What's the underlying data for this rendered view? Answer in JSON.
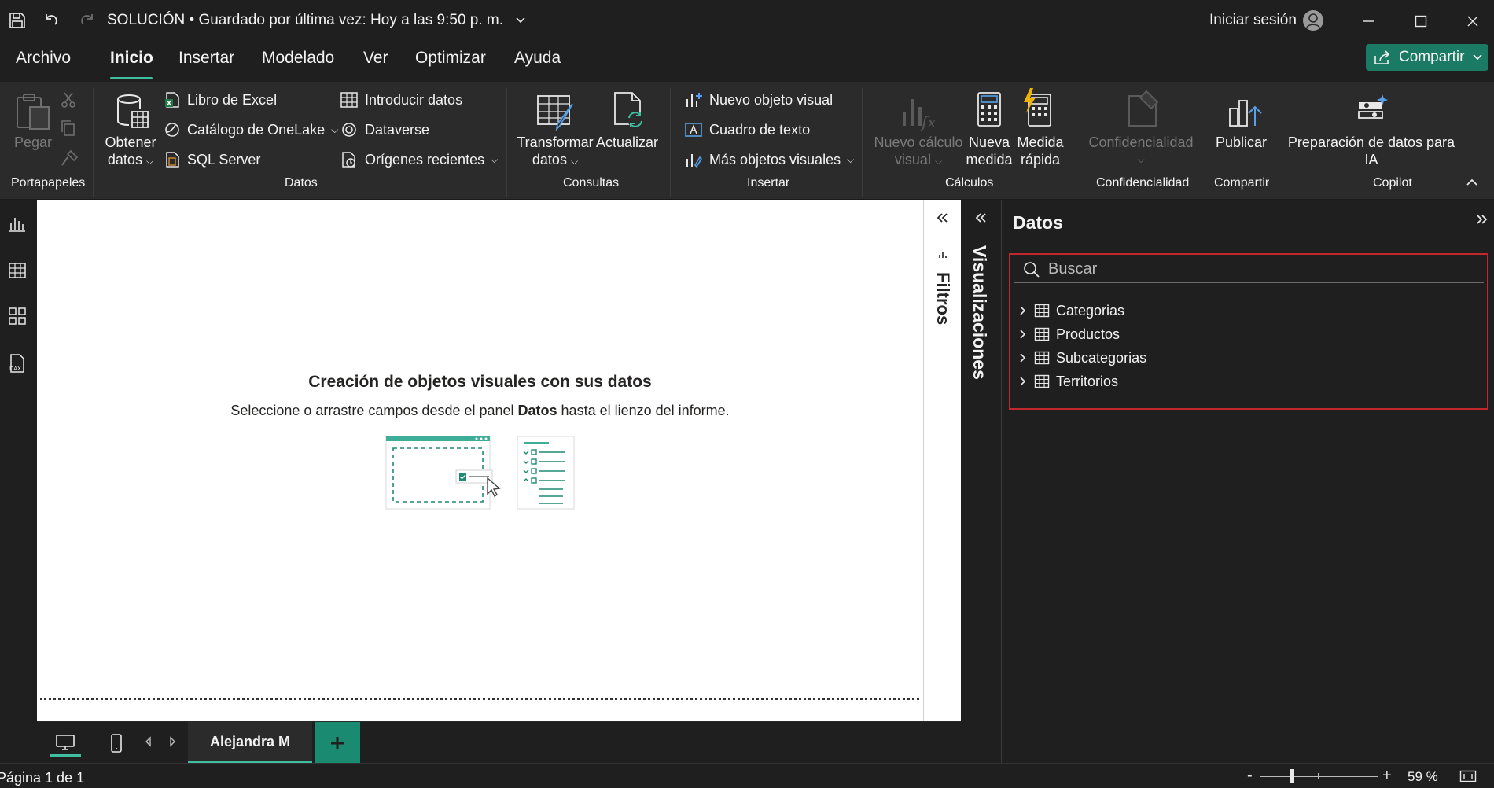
{
  "titlebar": {
    "title": "SOLUCIÓN • Guardado por última vez: Hoy a las 9:50 p. m.",
    "signin": "Iniciar sesión"
  },
  "menu": {
    "items": [
      "Archivo",
      "Inicio",
      "Insertar",
      "Modelado",
      "Ver",
      "Optimizar",
      "Ayuda"
    ],
    "active": "Inicio",
    "share": "Compartir"
  },
  "ribbon": {
    "paste": "Pegar",
    "clipboard_group": "Portapapeles",
    "get_data_1": "Obtener",
    "get_data_2": "datos",
    "excel": "Libro de Excel",
    "onelake": "Catálogo de OneLake",
    "sql": "SQL Server",
    "enter_data": "Introducir datos",
    "dataverse": "Dataverse",
    "recent": "Orígenes recientes",
    "data_group": "Datos",
    "transform_1": "Transformar",
    "transform_2": "datos",
    "refresh": "Actualizar",
    "queries_group": "Consultas",
    "new_visual": "Nuevo objeto visual",
    "textbox": "Cuadro de texto",
    "more_visuals": "Más objetos visuales",
    "insert_group": "Insertar",
    "new_calc_1": "Nuevo cálculo",
    "new_calc_2": "visual",
    "new_measure_1": "Nueva",
    "new_measure_2": "medida",
    "quick_measure_1": "Medida",
    "quick_measure_2": "rápida",
    "calc_group": "Cálculos",
    "sensitivity": "Confidencialidad",
    "sensitivity_group": "Confidencialidad",
    "publish": "Publicar",
    "share_group": "Compartir",
    "ai_prep_1": "Preparación de datos para",
    "ai_prep_2": "IA",
    "copilot_group": "Copilot"
  },
  "canvas": {
    "title": "Creación de objetos visuales con sus datos",
    "sub_before": "Seleccione o arrastre campos desde el panel ",
    "sub_bold": "Datos",
    "sub_after": " hasta el lienzo del informe."
  },
  "filters": {
    "label": "Filtros"
  },
  "visualizations": {
    "label": "Visualizaciones"
  },
  "data_pane": {
    "title": "Datos",
    "search_placeholder": "Buscar",
    "tables": [
      "Categorias",
      "Productos",
      "Subcategorias",
      "Territorios"
    ]
  },
  "pages": {
    "tab": "Alejandra M",
    "page_indicator": "Página 1 de 1"
  },
  "zoom": {
    "value": "59 %",
    "percent": 59
  },
  "colors": {
    "accent": "#3fbfa0",
    "share_button": "#1a7a64",
    "highlight_border": "#c4262e"
  }
}
